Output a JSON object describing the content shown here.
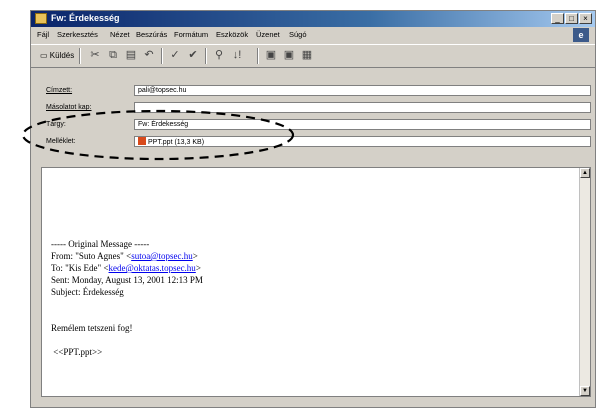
{
  "window": {
    "title": "Fw: Érdekesség",
    "min": "_",
    "max": "□",
    "close": "×"
  },
  "menu": [
    "Fájl",
    "Szerkesztés",
    "Nézet",
    "Beszúrás",
    "Formátum",
    "Eszközök",
    "Üzenet",
    "Súgó"
  ],
  "toolbar": {
    "send_label": "Küldés"
  },
  "header": {
    "to_label": "Címzett:",
    "to_value": "pali@topsec.hu",
    "cc_label": "Másolatot kap:",
    "cc_value": "",
    "subject_label": "Tárgy:",
    "subject_value": "Fw: Érdekesség",
    "attach_label": "Melléklet:",
    "attach_value": "PPT.ppt (13,3 KB)"
  },
  "message": {
    "original": "----- Original Message -----",
    "from_prefix": "From: \"Suto Agnes\" <",
    "from_email": "sutoa@topsec.hu",
    "from_suffix": ">",
    "to_prefix": "To: \"Kis Ede\" <",
    "to_email": "kede@oktatas.topsec.hu",
    "to_suffix": ">",
    "sent": "Sent: Monday, August 13, 2001 12:13 PM",
    "subject": "Subject: Érdekesség",
    "greeting": "Remélem tetszeni fog!",
    "attachment_ref": "<<PPT.ppt>>"
  }
}
